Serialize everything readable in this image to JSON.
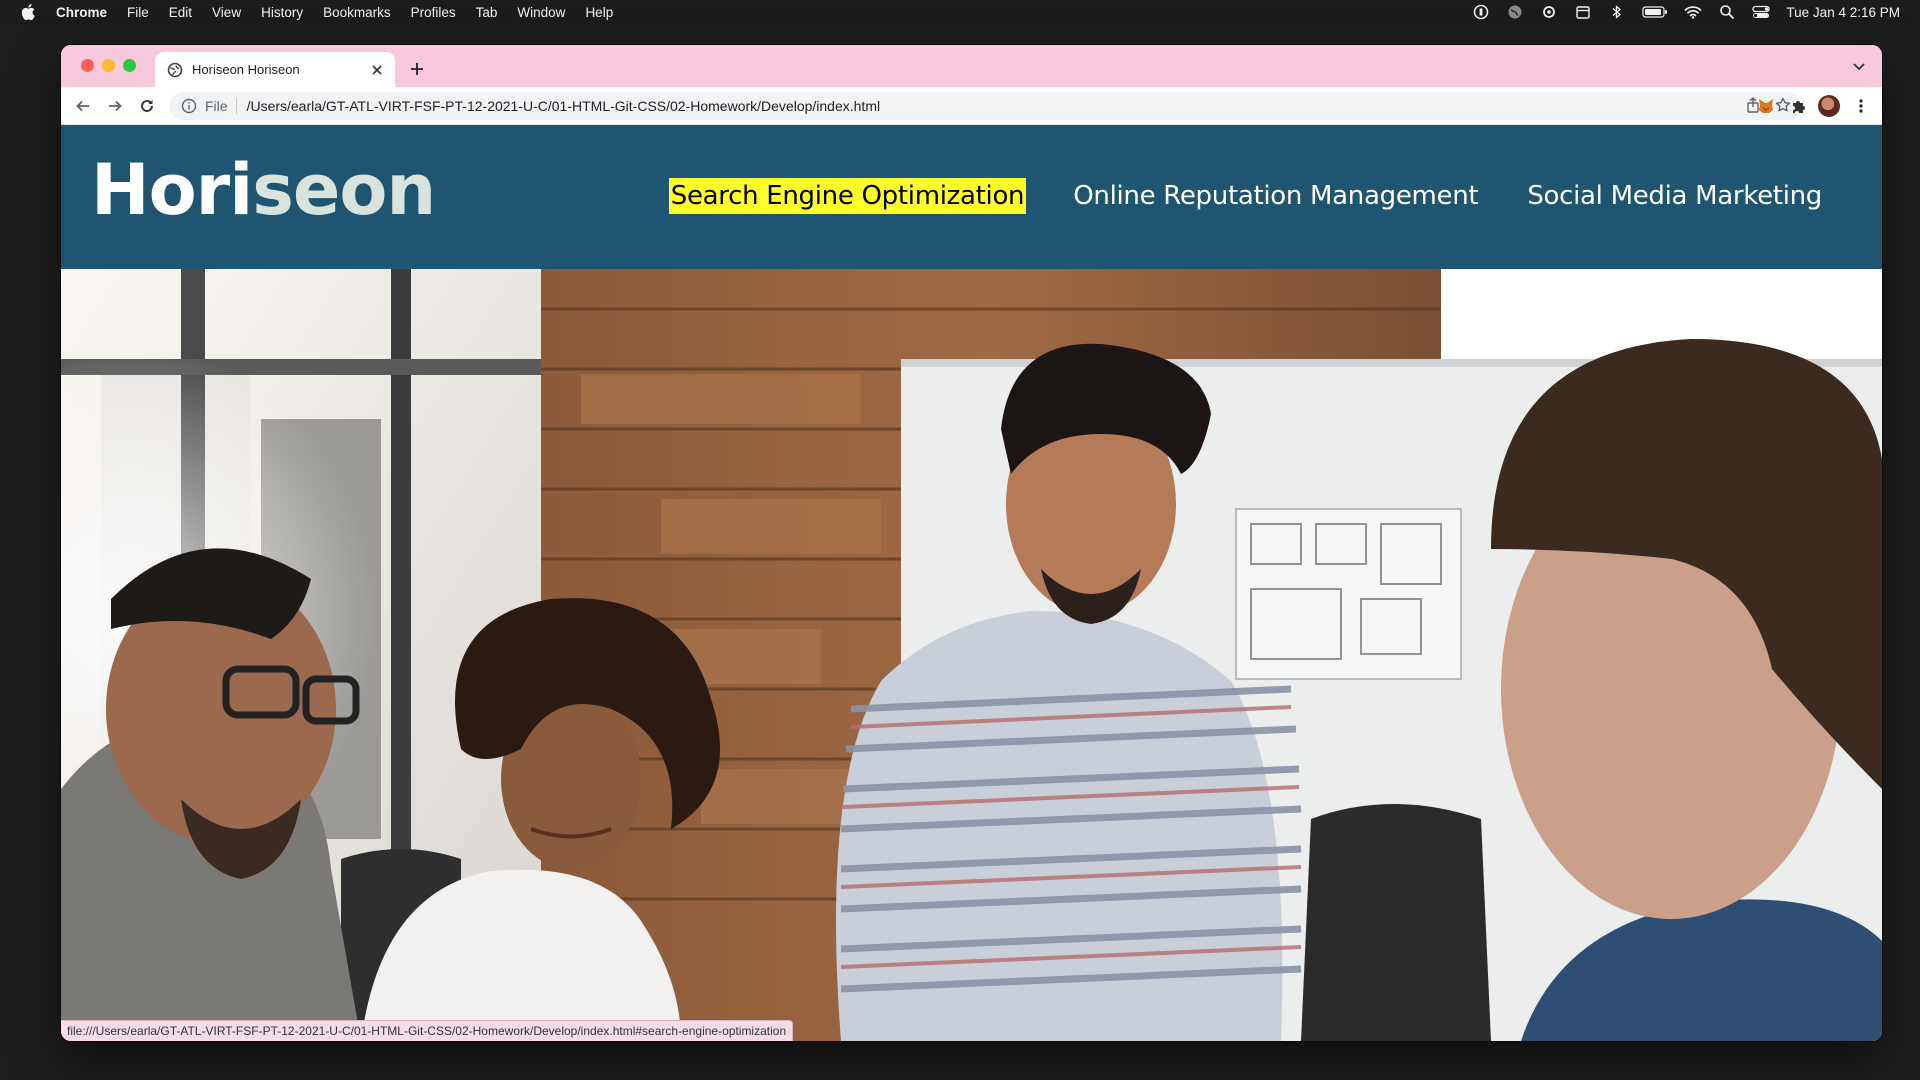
{
  "menubar": {
    "app_name": "Chrome",
    "items": [
      "File",
      "Edit",
      "View",
      "History",
      "Bookmarks",
      "Profiles",
      "Tab",
      "Window",
      "Help"
    ],
    "clock": "Tue Jan 4  2:16 PM"
  },
  "browser": {
    "tab_title": "Horiseon Horiseon",
    "url_scheme": "File",
    "url_path": "/Users/earla/GT-ATL-VIRT-FSF-PT-12-2021-U-C/01-HTML-Git-CSS/02-Homework/Develop/index.html",
    "status_url": "file:///Users/earla/GT-ATL-VIRT-FSF-PT-12-2021-U-C/01-HTML-Git-CSS/02-Homework/Develop/index.html#search-engine-optimization",
    "tabstrip_color": "#f8c9dd"
  },
  "page": {
    "logo_main": "Hori",
    "logo_accent": "seon",
    "nav": [
      {
        "label": "Search Engine Optimization",
        "active": true
      },
      {
        "label": "Online Reputation Management",
        "active": false
      },
      {
        "label": "Social Media Marketing",
        "active": false
      }
    ],
    "header_color": "#1f5571",
    "highlight_color": "#fffd2c"
  }
}
